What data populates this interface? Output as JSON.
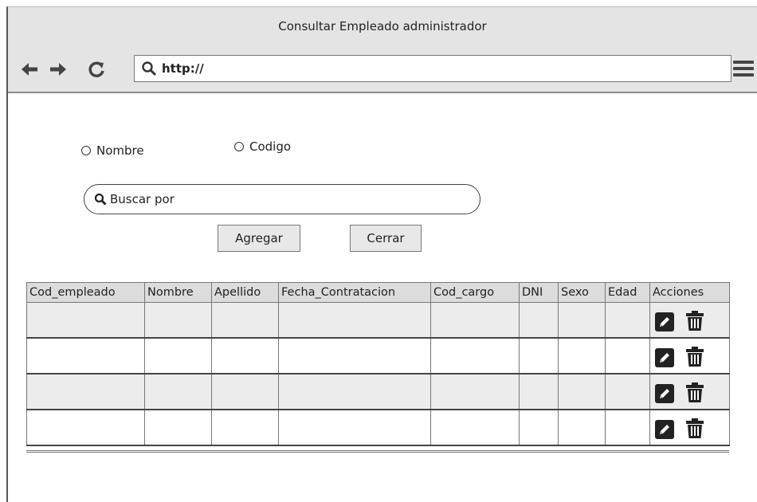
{
  "window": {
    "title": "Consultar Empleado administrador"
  },
  "browser": {
    "url": "http://",
    "icons": [
      "arrow-left-icon",
      "arrow-right-icon",
      "reload-icon",
      "search-icon",
      "hamburger-menu-icon"
    ]
  },
  "filters": {
    "option_nombre": "Nombre",
    "option_codigo": "Codigo"
  },
  "search": {
    "placeholder": "Buscar por"
  },
  "buttons": {
    "agregar": "Agregar",
    "cerrar": "Cerrar"
  },
  "table": {
    "columns": [
      "Cod_empleado",
      "Nombre",
      "Apellido",
      "Fecha_Contratacion",
      "Cod_cargo",
      "DNI",
      "Sexo",
      "Edad",
      "Acciones"
    ],
    "rows": [
      [
        "",
        "",
        "",
        "",
        "",
        "",
        "",
        ""
      ],
      [
        "",
        "",
        "",
        "",
        "",
        "",
        "",
        ""
      ],
      [
        "",
        "",
        "",
        "",
        "",
        "",
        "",
        ""
      ],
      [
        "",
        "",
        "",
        "",
        "",
        "",
        "",
        ""
      ]
    ],
    "row_actions": [
      "edit-icon",
      "trash-icon"
    ]
  },
  "colors": {
    "chrome": "#e4e4e4",
    "header_row": "#dcdcdc",
    "alt_row": "#ececec"
  }
}
